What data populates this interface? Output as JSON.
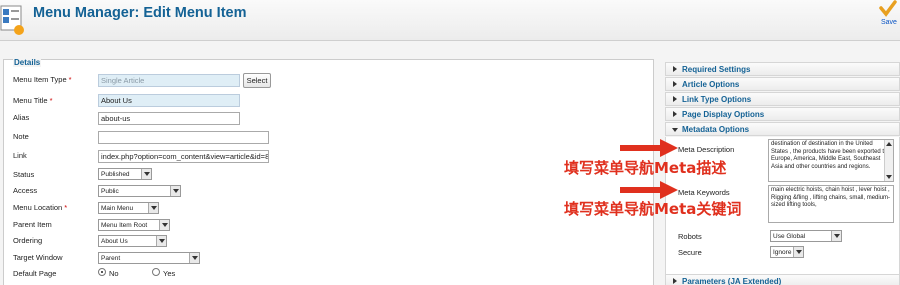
{
  "header": {
    "title": "Menu Manager: Edit Menu Item",
    "save_label": "Save"
  },
  "details": {
    "legend": "Details",
    "fields": {
      "menu_item_type": {
        "label": "Menu Item Type",
        "value": "Single Article",
        "button": "Select"
      },
      "menu_title": {
        "label": "Menu Title",
        "value": "About Us"
      },
      "alias": {
        "label": "Alias",
        "value": "about-us"
      },
      "note": {
        "label": "Note",
        "value": ""
      },
      "link": {
        "label": "Link",
        "value": "index.php?option=com_content&view=article&id=8"
      },
      "status": {
        "label": "Status",
        "value": "Published"
      },
      "access": {
        "label": "Access",
        "value": "Public"
      },
      "menu_location": {
        "label": "Menu Location",
        "value": "Main Menu"
      },
      "parent_item": {
        "label": "Parent Item",
        "value": "Menu Item Root"
      },
      "ordering": {
        "label": "Ordering",
        "value": "About Us"
      },
      "target_window": {
        "label": "Target Window",
        "value": "Parent"
      },
      "default_page": {
        "label": "Default Page",
        "options": [
          "No",
          "Yes"
        ],
        "selected": "No"
      }
    },
    "required_mark": "*"
  },
  "sidebar": {
    "panels": [
      "Required Settings",
      "Article Options",
      "Link Type Options",
      "Page Display Options",
      "Metadata Options",
      "Parameters (JA Extended)"
    ],
    "metadata": {
      "meta_description": {
        "label": "Meta Description",
        "value": "destination of destination in the United States , the products have been exported to Europe, America, Middle East, Southeast Asia and other countries and regions."
      },
      "meta_keywords": {
        "label": "Meta Keywords",
        "value": "main electric hoists, chain hoist , lever hoist , Rigging &fling , lifting chains, small,  medium-sized lifting tools,"
      },
      "robots": {
        "label": "Robots",
        "value": "Use Global"
      },
      "secure": {
        "label": "Secure",
        "value": "Ignore"
      }
    }
  },
  "annotations": {
    "meta_description_note": "填写菜单导航Meta描述",
    "meta_keywords_note": "填写菜单导航Meta关键词",
    "arrow_color": "#e0301e"
  }
}
